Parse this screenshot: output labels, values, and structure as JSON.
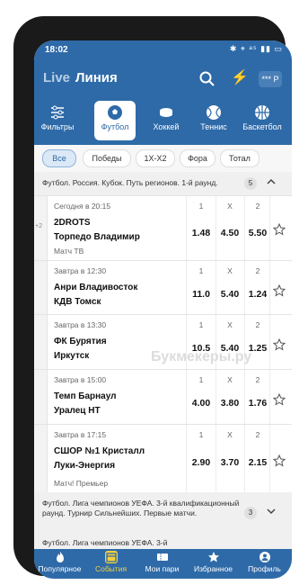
{
  "status": {
    "time": "18:02",
    "icons": "✱ ⌖ ᵃ⁵ ▮▮ ▭"
  },
  "header": {
    "live": "Live",
    "title": "Линия",
    "account": "*** P"
  },
  "sports": [
    {
      "label": "Фильтры",
      "icon": "filter-icon"
    },
    {
      "label": "Футбол",
      "icon": "soccer-ball-icon",
      "active": true
    },
    {
      "label": "Хоккей",
      "icon": "hockey-puck-icon"
    },
    {
      "label": "Теннис",
      "icon": "tennis-ball-icon"
    },
    {
      "label": "Баскетбол",
      "icon": "basketball-icon"
    }
  ],
  "filters": [
    "Все",
    "Победы",
    "1Х-Х2",
    "Фора",
    "Тотал"
  ],
  "group1": {
    "title": "Футбол. Россия. Кубок. Путь регионов. 1-й раунд.",
    "count": "5"
  },
  "odds_headers": [
    "1",
    "X",
    "2"
  ],
  "events": [
    {
      "time": "Сегодня в 20:15",
      "team1": "2DROTS",
      "team2": "Торпедо Владимир",
      "note": "Матч ТВ",
      "plus": "+2",
      "odds": [
        "1.48",
        "4.50",
        "5.50"
      ]
    },
    {
      "time": "Завтра в 12:30",
      "team1": "Анри Владивосток",
      "team2": "КДВ Томск",
      "note": "",
      "odds": [
        "11.0",
        "5.40",
        "1.24"
      ]
    },
    {
      "time": "Завтра в 13:30",
      "team1": "ФК Бурятия",
      "team2": "Иркутск",
      "note": "",
      "odds": [
        "10.5",
        "5.40",
        "1.25"
      ]
    },
    {
      "time": "Завтра в 15:00",
      "team1": "Темп Барнаул",
      "team2": "Уралец НТ",
      "note": "",
      "odds": [
        "4.00",
        "3.80",
        "1.76"
      ]
    },
    {
      "time": "Завтра в 17:15",
      "team1": "СШОР №1 Кристалл",
      "team2": "Луки-Энергия",
      "note": "Матч! Премьер",
      "odds": [
        "2.90",
        "3.70",
        "2.15"
      ]
    }
  ],
  "group2": {
    "title": "Футбол. Лига чемпионов УЕФА. 3-й квалификационный раунд. Турнир Сильнейших. Первые матчи.",
    "count": "3"
  },
  "group3": {
    "title": "Футбол. Лига чемпионов УЕФА. 3-й"
  },
  "watermark": "Букмекеры.ру",
  "nav": [
    {
      "label": "Популярное",
      "icon": "fire-icon"
    },
    {
      "label": "События",
      "icon": "calendar-icon",
      "active": true
    },
    {
      "label": "Мои пари",
      "icon": "ticket-icon"
    },
    {
      "label": "Избранное",
      "icon": "star-icon"
    },
    {
      "label": "Профиль",
      "icon": "profile-icon"
    }
  ],
  "colors": {
    "primary": "#2e6aa8",
    "active_nav": "#f4d03f"
  }
}
